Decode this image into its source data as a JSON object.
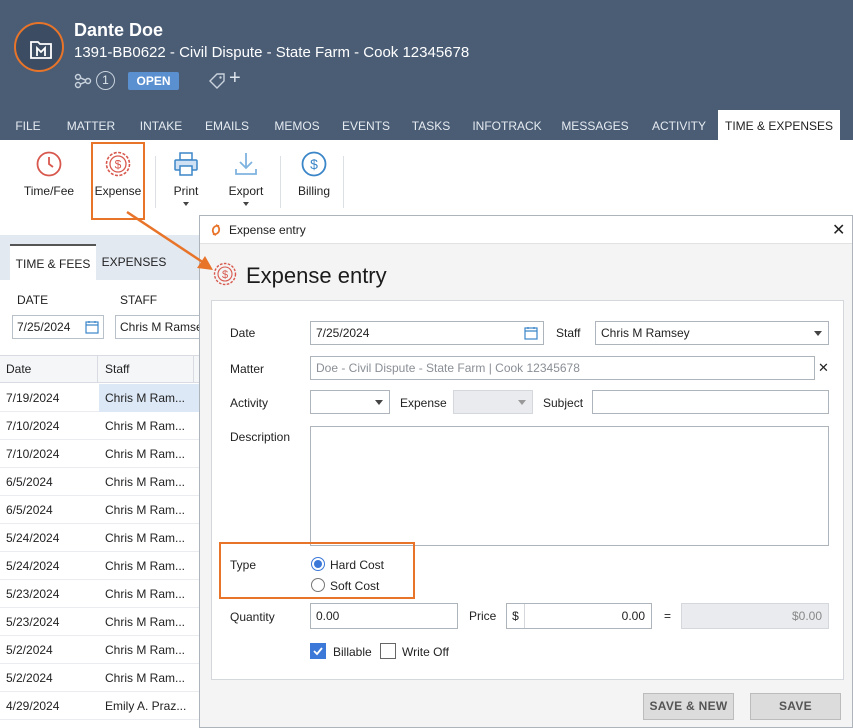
{
  "header": {
    "client_name": "Dante Doe",
    "matter_line": "1391-BB0622 - Civil Dispute - State Farm - Cook 12345678",
    "related_count": "1",
    "status": "OPEN",
    "tag_add": "+"
  },
  "tabs": [
    {
      "label": "FILE"
    },
    {
      "label": "MATTER"
    },
    {
      "label": "INTAKE"
    },
    {
      "label": "EMAILS"
    },
    {
      "label": "MEMOS"
    },
    {
      "label": "EVENTS"
    },
    {
      "label": "TASKS"
    },
    {
      "label": "INFOTRACK"
    },
    {
      "label": "MESSAGES"
    },
    {
      "label": "ACTIVITY"
    },
    {
      "label": "TIME & EXPENSES",
      "active": true
    }
  ],
  "toolbar": {
    "time_fee": "Time/Fee",
    "expense": "Expense",
    "print": "Print",
    "export": "Export",
    "billing": "Billing"
  },
  "left_panel": {
    "subtabs": [
      "TIME & FEES",
      "EXPENSES"
    ],
    "date_label": "DATE",
    "staff_label": "STAFF",
    "date_value": "7/25/2024",
    "staff_value": "Chris M Ramsey",
    "columns": [
      "Date",
      "Staff"
    ],
    "rows": [
      {
        "date": "7/19/2024",
        "staff": "Chris M Ram..."
      },
      {
        "date": "7/10/2024",
        "staff": "Chris M Ram..."
      },
      {
        "date": "7/10/2024",
        "staff": "Chris M Ram..."
      },
      {
        "date": "6/5/2024",
        "staff": "Chris M Ram..."
      },
      {
        "date": "6/5/2024",
        "staff": "Chris M Ram..."
      },
      {
        "date": "5/24/2024",
        "staff": "Chris M Ram..."
      },
      {
        "date": "5/24/2024",
        "staff": "Chris M Ram..."
      },
      {
        "date": "5/23/2024",
        "staff": "Chris M Ram..."
      },
      {
        "date": "5/23/2024",
        "staff": "Chris M Ram..."
      },
      {
        "date": "5/2/2024",
        "staff": "Chris M Ram..."
      },
      {
        "date": "5/2/2024",
        "staff": "Chris M Ram..."
      },
      {
        "date": "4/29/2024",
        "staff": "Emily A. Praz..."
      }
    ]
  },
  "dialog": {
    "title": "Expense entry",
    "heading": "Expense entry",
    "close": "✕",
    "date_label": "Date",
    "date_value": "7/25/2024",
    "staff_label": "Staff",
    "staff_value": "Chris M Ramsey",
    "matter_label": "Matter",
    "matter_value": "Doe - Civil Dispute - State Farm | Cook 12345678",
    "matter_clear": "✕",
    "activity_label": "Activity",
    "expense_label": "Expense",
    "subject_label": "Subject",
    "description_label": "Description",
    "type_label": "Type",
    "type_options": [
      "Hard Cost",
      "Soft Cost"
    ],
    "type_selected": "Hard Cost",
    "quantity_label": "Quantity",
    "quantity_value": "0.00",
    "price_label": "Price",
    "price_currency": "$",
    "price_value": "0.00",
    "equals": "=",
    "total_value": "$0.00",
    "billable_label": "Billable",
    "billable_checked": true,
    "writeoff_label": "Write Off",
    "writeoff_checked": false,
    "save_new": "SAVE & NEW",
    "save": "SAVE"
  },
  "colors": {
    "header_bg": "#4a5d75",
    "accent_orange": "#e8742a",
    "status_blue": "#5a8fd0",
    "check_blue": "#3b78d8",
    "icon_red": "#d8584e",
    "icon_blue": "#3b86c8"
  },
  "icons": [
    "matter-folder-icon",
    "related-icon",
    "tag-icon",
    "clock-icon",
    "dollar-badge-icon",
    "printer-icon",
    "download-icon",
    "dollar-circle-icon",
    "calendar-icon",
    "app-logo-icon",
    "close-icon"
  ]
}
